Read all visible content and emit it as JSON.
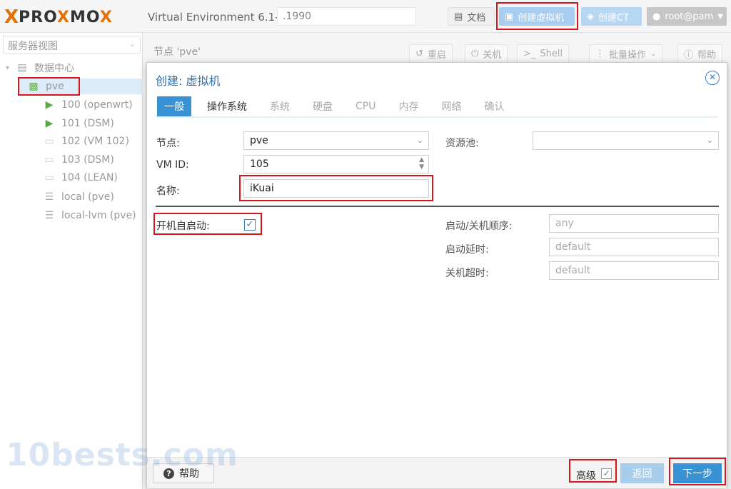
{
  "app": {
    "logo_x": "X",
    "logo_text_1": "PRO",
    "logo_x2": "X",
    "logo_text_2": "MO",
    "logo_x3": "X",
    "version": "Virtual Environment 6.1-7",
    "search_value": ".1990"
  },
  "toolbar": {
    "docs_label": "文档",
    "create_vm_label": "创建虚拟机",
    "create_ct_label": "创建CT",
    "user_label": "root@pam"
  },
  "tree": {
    "view_label": "服务器视图",
    "datacenter": "数据中心",
    "node": "pve",
    "items": [
      {
        "label": "100 (openwrt)",
        "running": true
      },
      {
        "label": "101 (DSM)",
        "running": true
      },
      {
        "label": "102 (VM 102)",
        "running": false
      },
      {
        "label": "103 (DSM)",
        "running": false
      },
      {
        "label": "104 (LEAN)",
        "running": false
      }
    ],
    "storages": [
      "local (pve)",
      "local-lvm (pve)"
    ]
  },
  "node_header": {
    "title": "节点 'pve'",
    "reboot": "重启",
    "shutdown": "关机",
    "shell": "Shell",
    "bulk": "批量操作",
    "help": "帮助"
  },
  "dialog": {
    "title": "创建: 虚拟机",
    "tabs": [
      "一般",
      "操作系统",
      "系统",
      "硬盘",
      "CPU",
      "内存",
      "网络",
      "确认"
    ],
    "node_label": "节点:",
    "node_value": "pve",
    "vmid_label": "VM ID:",
    "vmid_value": "105",
    "name_label": "名称:",
    "name_value": "iKuai",
    "pool_label": "资源池:",
    "pool_value": "",
    "autostart_label": "开机自启动:",
    "autostart_checked": true,
    "order_label": "启动/关机顺序:",
    "order_value": "any",
    "delay_label": "启动延时:",
    "delay_value": "default",
    "timeout_label": "关机超时:",
    "timeout_value": "default",
    "help_label": "帮助",
    "advanced_label": "高级",
    "back_label": "返回",
    "next_label": "下一步"
  },
  "watermark": "10bests.com"
}
